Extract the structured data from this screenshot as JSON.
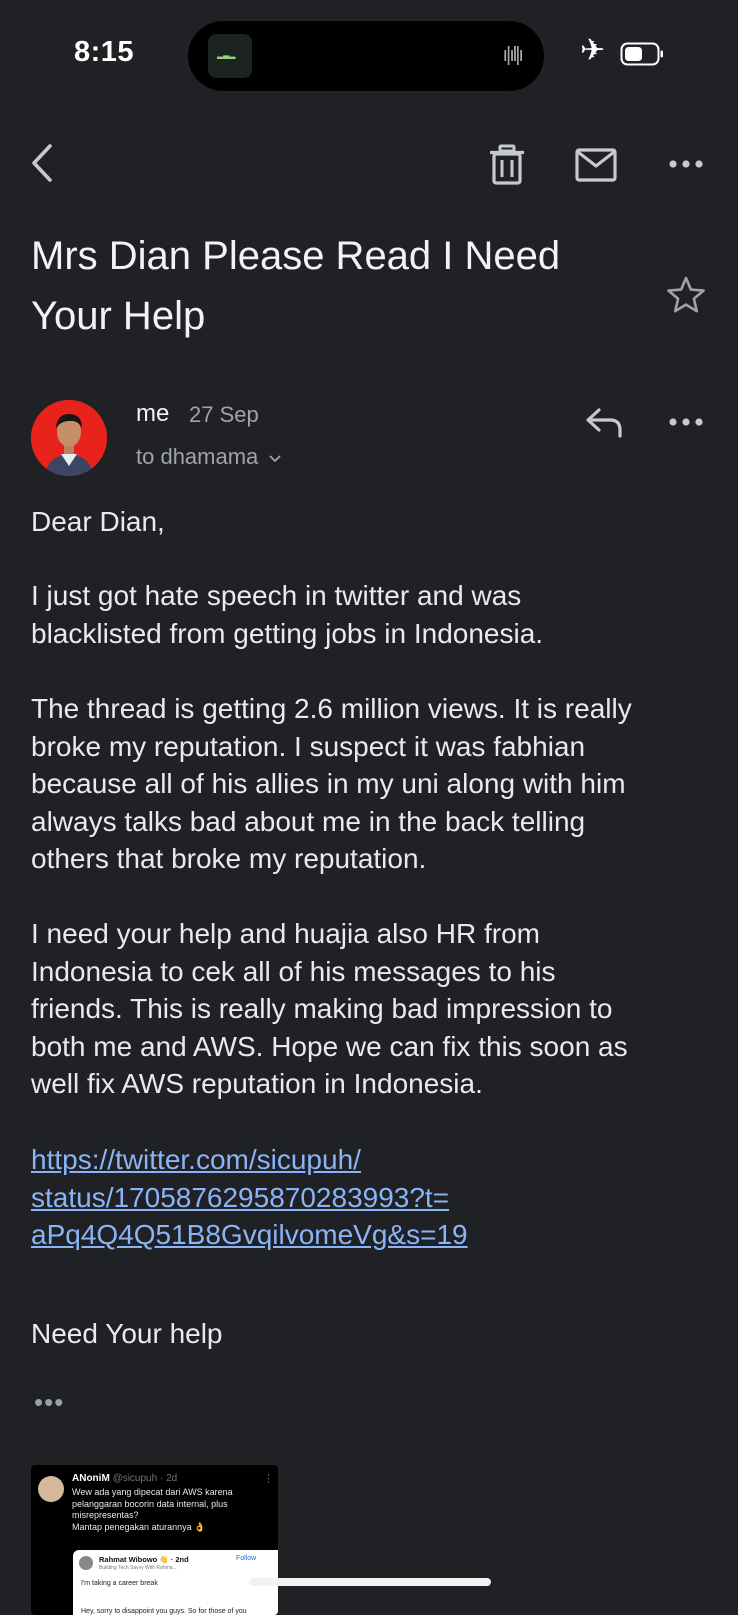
{
  "status_bar": {
    "time": "8:15",
    "icons": [
      "dynamic-island",
      "audio-wave-icon",
      "airplane-icon",
      "battery-icon"
    ]
  },
  "toolbar": {
    "icons": [
      "back-arrow-icon",
      "trash-icon",
      "mail-icon",
      "more-vert-icon"
    ]
  },
  "email": {
    "subject_line1": "Mrs Dian Please Read I Need",
    "subject_line2": "Your Help",
    "sender": "me",
    "date": "27 Sep",
    "recipient": "to dhamama",
    "greeting": "Dear Dian,",
    "paragraphs": [
      [
        "I just got hate speech in twitter and was",
        "blacklisted from getting jobs in Indonesia."
      ],
      [
        "The thread is getting 2.6 million views. It is really",
        "broke my reputation. I suspect it was fabhian",
        "because all of his allies in my uni along with him",
        "always talks bad about me in the back telling",
        "others that broke my reputation."
      ],
      [
        "I need your help and huajia also HR from",
        "Indonesia to cek all of his messages to his",
        "friends. This is really making bad impression to",
        "both me and AWS. Hope we can fix this soon as",
        "well fix AWS reputation in Indonesia."
      ]
    ],
    "link_lines": [
      "https://twitter.com/sicupuh/",
      "status/1705876295870283993?t=",
      "aPq4Q4Q51B8GvqilvomeVg&s=19"
    ],
    "signoff": "Need Your help",
    "trimmed_content_label": "•••"
  },
  "preview": {
    "author": "ANoniM",
    "handle_time": "@sicupuh · 2d",
    "text_lines": [
      "Wew ada yang dipecat dari AWS karena",
      "pelanggaran bocorin data internal, plus",
      "misrepresentas?",
      "Mantap penegakan aturannya 👌"
    ],
    "quoted_name": "Rahmat Wibowo 👋 · 2nd",
    "quoted_sub": "Building Tech Savvy With Rahma...",
    "quoted_follow": "Follow",
    "quoted_line1": "I'm taking a career break",
    "quoted_line2": "Hey, sorry to disappoint you guys. So for those of you"
  },
  "colors": {
    "background": "#202124",
    "text": "#e8eaed",
    "secondary_text": "#a0a3a8",
    "link": "#8ab4f8",
    "avatar_bg": "#e8231c"
  }
}
